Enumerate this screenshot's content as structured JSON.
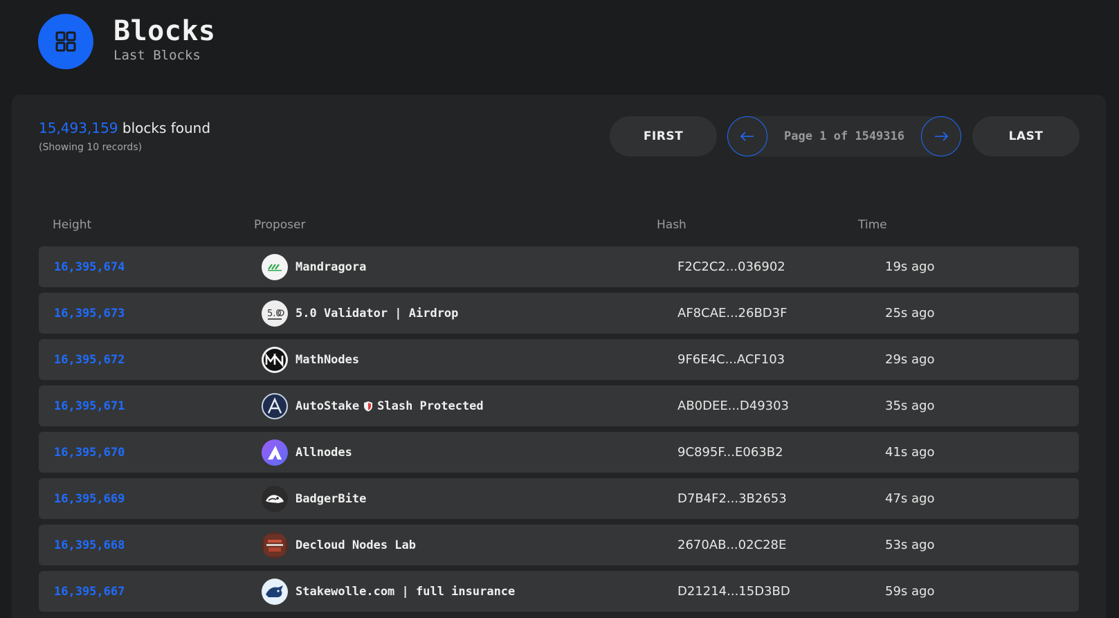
{
  "header": {
    "title": "Blocks",
    "subtitle": "Last Blocks",
    "icon": "grid-icon",
    "accent": "#1765f5"
  },
  "summary": {
    "count": "15,493,159",
    "count_suffix": " blocks found",
    "showing": "(Showing 10 records)"
  },
  "pagination": {
    "first_label": "FIRST",
    "last_label": "LAST",
    "page_text": "Page 1 of 1549316",
    "prev_icon": "arrow-left-icon",
    "next_icon": "arrow-right-icon"
  },
  "table": {
    "columns": [
      "Height",
      "Proposer",
      "Hash",
      "Time"
    ],
    "rows": [
      {
        "height": "16,395,674",
        "proposer": "Mandragora",
        "hash": "F2C2C2...036902",
        "time": "19s ago",
        "avatar": "mandragora-logo"
      },
      {
        "height": "16,395,673",
        "proposer": "5.0 Validator | Airdrop",
        "hash": "AF8CAE...26BD3F",
        "time": "25s ago",
        "avatar": "five-validator-logo"
      },
      {
        "height": "16,395,672",
        "proposer": "MathNodes",
        "hash": "9F6E4C...ACF103",
        "time": "29s ago",
        "avatar": "mathnodes-logo"
      },
      {
        "height": "16,395,671",
        "proposer_a": "AutoStake",
        "proposer_b": "Slash Protected",
        "hash": "AB0DEE...D49303",
        "time": "35s ago",
        "avatar": "autostake-logo"
      },
      {
        "height": "16,395,670",
        "proposer": "Allnodes",
        "hash": "9C895F...E063B2",
        "time": "41s ago",
        "avatar": "allnodes-logo"
      },
      {
        "height": "16,395,669",
        "proposer": "BadgerBite",
        "hash": "D7B4F2...3B2653",
        "time": "47s ago",
        "avatar": "badgerbite-logo"
      },
      {
        "height": "16,395,668",
        "proposer": "Decloud Nodes Lab",
        "hash": "2670AB...02C28E",
        "time": "53s ago",
        "avatar": "decloud-logo"
      },
      {
        "height": "16,395,667",
        "proposer": "Stakewolle.com | full insurance",
        "hash": "D21214...15D3BD",
        "time": "59s ago",
        "avatar": "stakewolle-logo"
      }
    ]
  }
}
